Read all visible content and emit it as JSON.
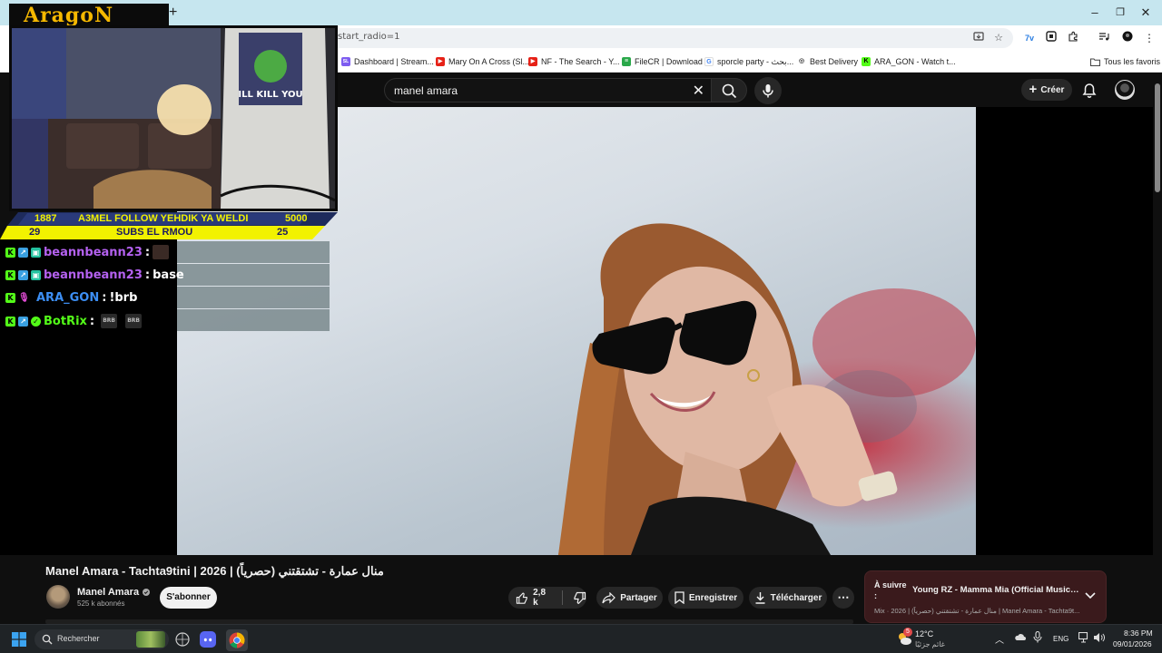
{
  "browser": {
    "url_fragment": "start_radio=1",
    "bookmarks": [
      {
        "label": "Dashboard | Stream...",
        "color": "#7d5cf0",
        "glyph": "SL"
      },
      {
        "label": "Mary On A Cross (Sl...",
        "color": "#e62117",
        "glyph": "▶"
      },
      {
        "label": "NF - The Search - Y...",
        "color": "#e62117",
        "glyph": "▶"
      },
      {
        "label": "FileCR | Download",
        "color": "#2aa84a",
        "glyph": "≡"
      },
      {
        "label": "sporcle party - بحث...",
        "color": "#4285f4",
        "glyph": "G"
      },
      {
        "label": "Best Delivery",
        "color": "#666666",
        "glyph": "◎"
      },
      {
        "label": "ARA_GON - Watch t...",
        "color": "#53fc18",
        "glyph": "K"
      }
    ],
    "all_bookmarks_label": "Tous les favoris",
    "window_controls": {
      "minimize": "–",
      "maximize": "❐",
      "close": "✕"
    },
    "new_tab": "+"
  },
  "overlay": {
    "logo": "AragoN",
    "goal": {
      "follow_count": "1887",
      "follow_text": "A3MEL FOLLOW YEHDIK YA WELDI",
      "follow_goal": "5000",
      "subs_count": "29",
      "subs_text": "SUBS EL RMOU",
      "subs_goal": "25"
    },
    "chat": [
      {
        "user": "beannbeann23",
        "user_color": "#b461f0",
        "sep": ":",
        "text": "",
        "emote": true
      },
      {
        "user": "beannbeann23",
        "user_color": "#b461f0",
        "sep": ":",
        "text": "base",
        "emote": false
      },
      {
        "user": "ARA_GON",
        "user_color": "#3c8ef3",
        "sep": ":",
        "text": "!brb",
        "emote": false
      },
      {
        "user": "BotRix",
        "user_color": "#53fc18",
        "sep": ":",
        "text": "",
        "emote": false,
        "brb": [
          "BRB",
          "BRB"
        ]
      }
    ],
    "cam_shirt_text": "ILL KILL YOU"
  },
  "youtube": {
    "search_value": "manel amara",
    "create_label": "Créer",
    "video_title": "Manel Amara - Tachta9tini | منال عمارة - تشتقتني (حصرياً) | 2026",
    "channel_name": "Manel Amara",
    "subscribers": "525 k abonnés",
    "subscribe_label": "S'abonner",
    "likes": "2,8 k",
    "share_label": "Partager",
    "save_label": "Enregistrer",
    "download_label": "Télécharger",
    "more_label": "⋯",
    "up_next": {
      "label": "À suivre :",
      "title": "Young RZ - Mamma Mia (Official Music Vi...",
      "subtitle": "Mix · 2026 | منال عمارة - تشتقتني (حصرياً) | Manel Amara - Tachta9t..."
    }
  },
  "taskbar": {
    "search_placeholder": "Rechercher",
    "weather_temp": "12°C",
    "weather_desc": "غائم جزئيًا",
    "weather_badge": "5",
    "language": "ENG",
    "time": "8:36 PM",
    "date": "09/01/2026"
  }
}
